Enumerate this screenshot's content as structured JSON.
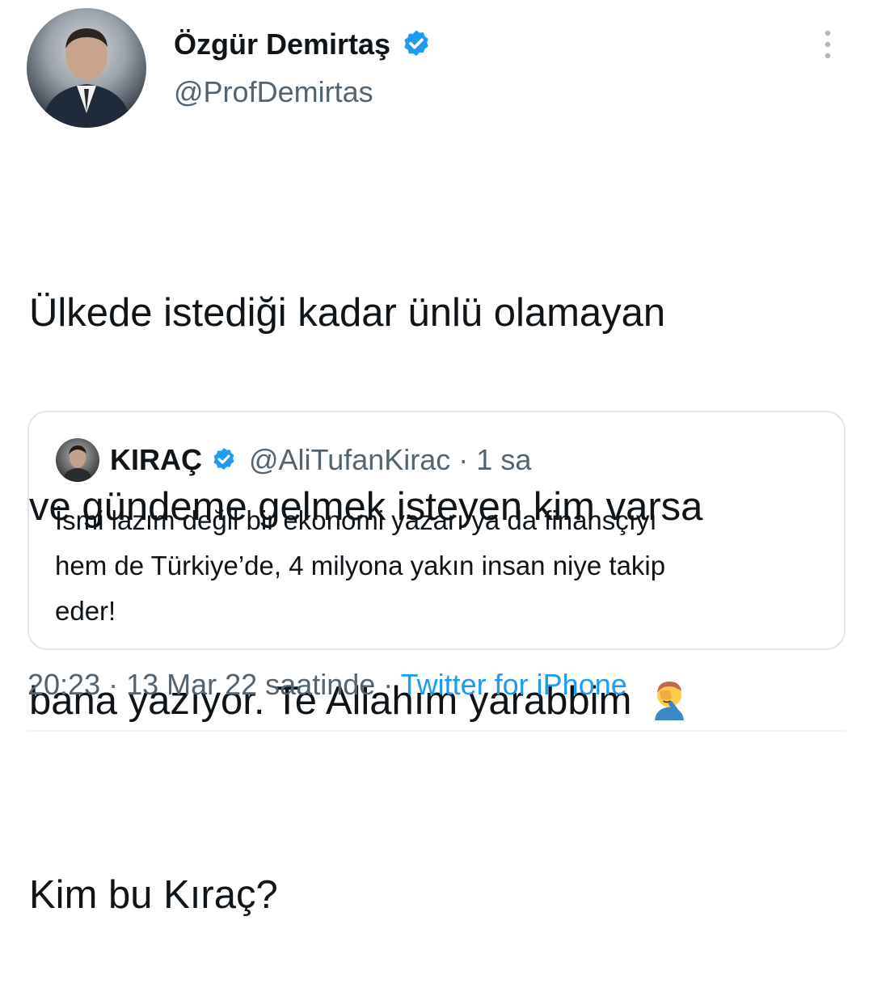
{
  "author": {
    "name": "Özgür Demirtaş",
    "handle": "@ProfDemirtas"
  },
  "tweet": {
    "lines": [
      "Ülkede istediği kadar ünlü olamayan",
      "ve gündeme gelmek isteyen kim varsa",
      "bana yazıyor. Te Allahım yarabbim",
      "Kim bu Kıraç?"
    ],
    "emoji": "facepalm-emoji"
  },
  "quoted": {
    "name": "KIRAÇ",
    "handle": "@AliTufanKirac",
    "separator": "·",
    "time": "1 sa",
    "text_lines": [
      "İsmi lazım değil bir ekonomi yazarı ya da finansçıyı",
      "hem de Türkiye’de, 4 milyona yakın insan niye takip",
      "eder!"
    ]
  },
  "meta": {
    "time": "20:23",
    "sep1": " · ",
    "date": "13 Mar 22 saatinde",
    "sep2": " · ",
    "source": "Twitter for iPhone"
  },
  "colors": {
    "verified": "#1d9bf0",
    "link": "#1d9bf0",
    "secondary_text": "#536471"
  }
}
